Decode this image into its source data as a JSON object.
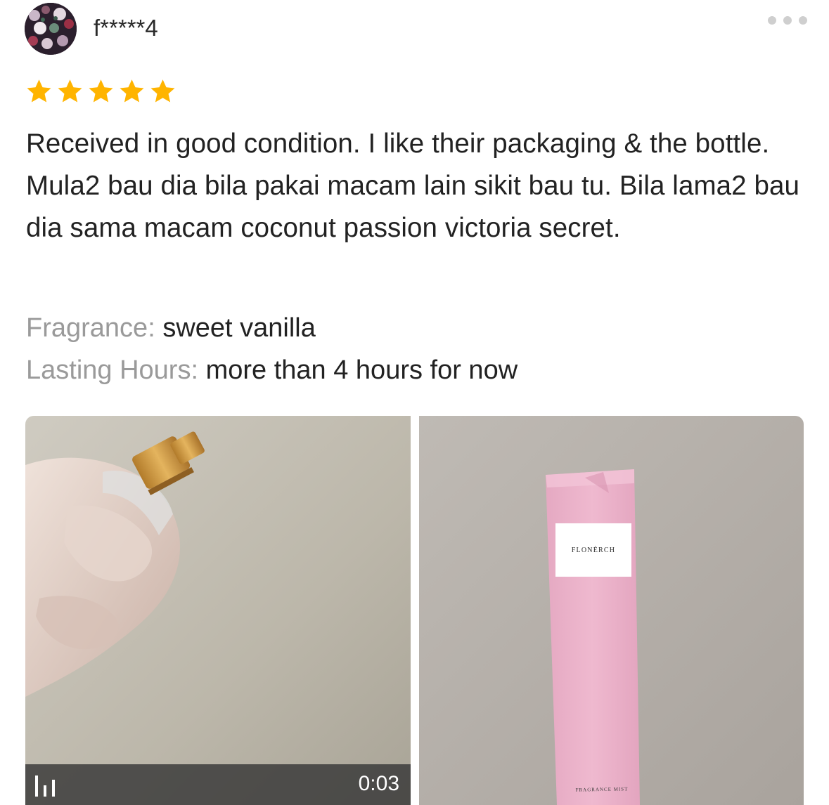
{
  "reviewer": {
    "name": "f*****4"
  },
  "rating": {
    "stars": 5,
    "max": 5,
    "star_color": "#FFB400"
  },
  "review": {
    "text": "Received in good condition. I like their packaging & the bottle. Mula2 bau dia bila pakai macam lain sikit bau tu. Bila lama2 bau dia sama macam coconut passion victoria secret."
  },
  "attributes": [
    {
      "label": "Fragrance:",
      "value": "sweet vanilla"
    },
    {
      "label": "Lasting Hours:",
      "value": "more than 4 hours for now"
    }
  ],
  "media": {
    "video": {
      "duration": "0:03",
      "icon": "audio-bars-icon"
    },
    "photo": {
      "brand_text": "FLONÈRCH",
      "bottom_text": "FRAGRANCE MIST"
    }
  },
  "menu": {
    "icon": "more-dots-icon"
  }
}
